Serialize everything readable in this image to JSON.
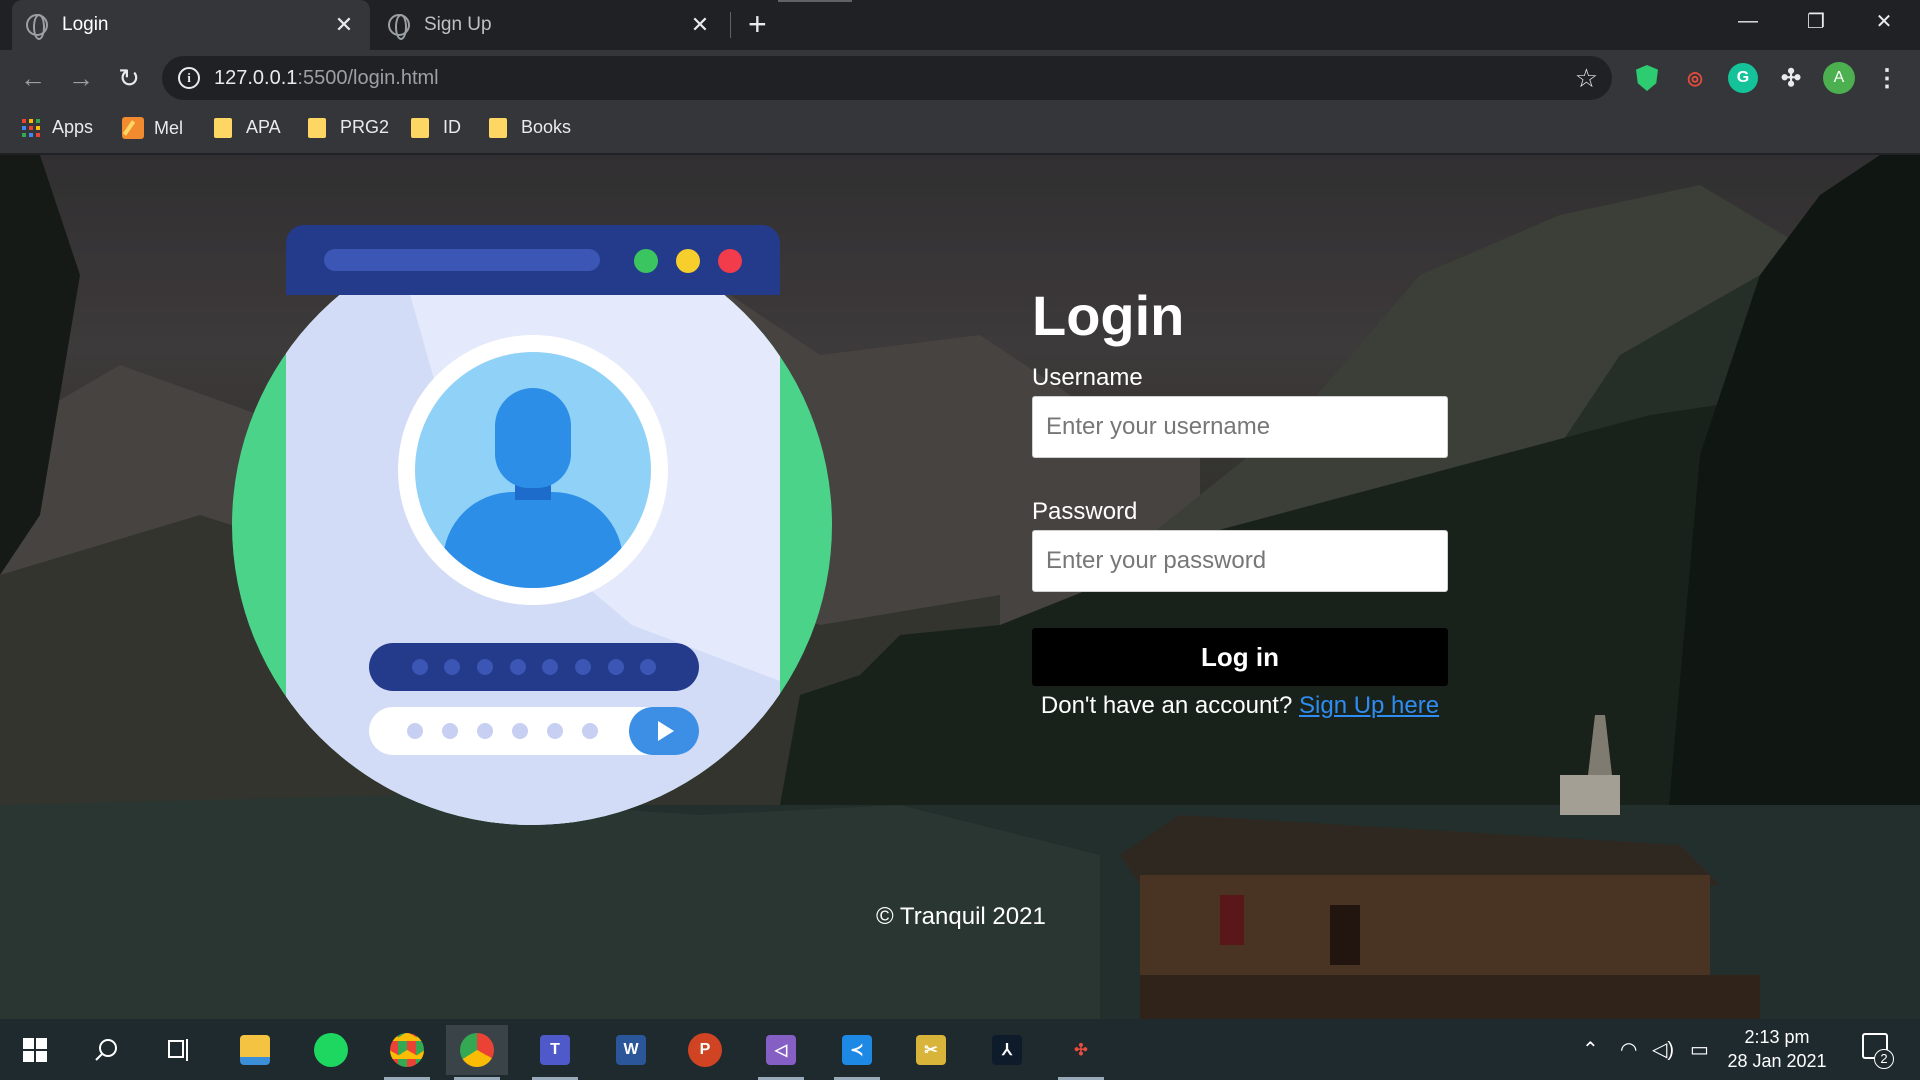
{
  "browser": {
    "tabs": [
      {
        "label": "Login",
        "active": true
      },
      {
        "label": "Sign Up",
        "active": false
      }
    ],
    "new_tab_symbol": "+",
    "close_symbol": "✕",
    "window_controls": {
      "minimize": "—",
      "restore": "❐",
      "close": "✕"
    },
    "nav": {
      "back": "←",
      "forward": "→",
      "reload": "↻"
    },
    "url_host": "127.0.0.1",
    "url_rest": ":5500/login.html",
    "bookmark_star": "☆",
    "profile_initial": "A",
    "grammarly_initial": "G",
    "menu_symbol": "⋮",
    "bookmarks": [
      {
        "label": "Apps",
        "icon": "apps-grid-icon"
      },
      {
        "label": "Mel",
        "icon": "notepad-icon"
      },
      {
        "label": "APA",
        "icon": "folder-icon"
      },
      {
        "label": "PRG2",
        "icon": "folder-icon"
      },
      {
        "label": "ID",
        "icon": "folder-icon"
      },
      {
        "label": "Books",
        "icon": "folder-icon"
      }
    ]
  },
  "page": {
    "title": "Login",
    "username_label": "Username",
    "username_placeholder": "Enter your username",
    "username_value": "",
    "password_label": "Password",
    "password_placeholder": "Enter your password",
    "password_value": "",
    "login_button": "Log in",
    "signup_prompt": "Don't have an account?",
    "signup_link": "Sign Up here",
    "footer": "© Tranquil 2021"
  },
  "taskbar": {
    "apps": [
      "windows-start-icon",
      "search-icon",
      "task-view-icon",
      "file-explorer-icon",
      "spotify-icon",
      "chrome-icon",
      "chrome-profile-icon",
      "teams-icon",
      "word-icon",
      "powerpoint-icon",
      "visual-studio-icon",
      "vscode-icon",
      "snipping-tool-icon",
      "acrobat-icon",
      "git-icon"
    ],
    "time": "2:13 pm",
    "date": "28 Jan 2021",
    "notification_count": "2"
  },
  "colors": {
    "illustration_green": "#4cd38a",
    "illustration_navy": "#243a8a",
    "avatar_blue": "#2d8ee8",
    "link_blue": "#2f8cf0",
    "button_black": "#000000",
    "traffic_green": "#3ac561",
    "traffic_yellow": "#f7cf2d",
    "traffic_red": "#f23b4b"
  }
}
